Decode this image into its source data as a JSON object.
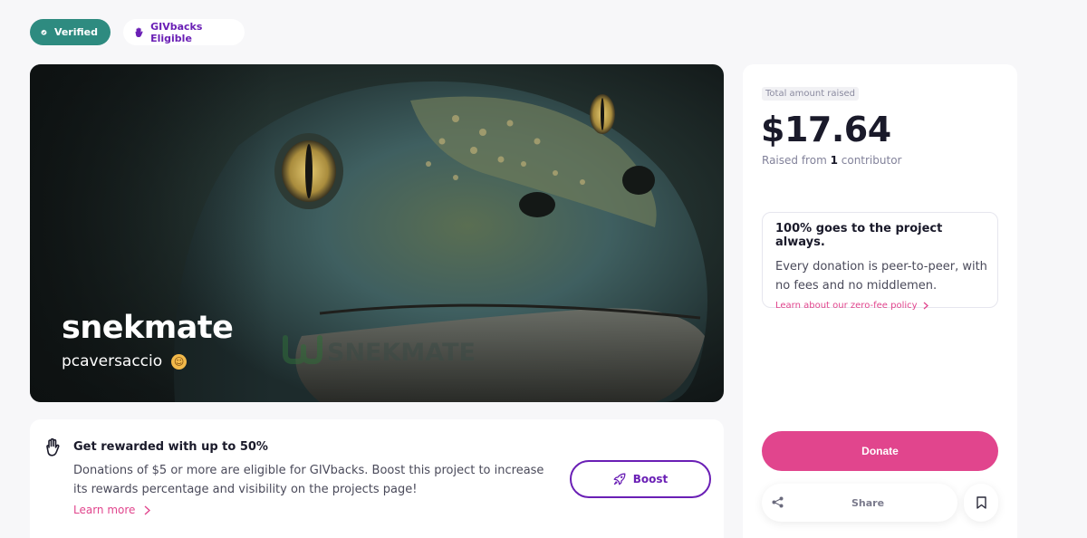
{
  "badges": {
    "verified": "Verified",
    "givbacks": "GIVbacks Eligible"
  },
  "project": {
    "title": "snekmate",
    "author": "pcaversaccio",
    "watermark": "SNEKMATE"
  },
  "donation_panel": {
    "total_label": "Total amount raised",
    "amount": "$17.64",
    "raised_prefix": "Raised from ",
    "contributor_count": "1",
    "raised_suffix": " contributor",
    "fee_card": {
      "title": "100% goes to the project always.",
      "body": "Every donation is peer-to-peer, with no fees and no middlemen.",
      "link": "Learn about our zero-fee policy"
    },
    "donate_label": "Donate",
    "share_label": "Share"
  },
  "reward_card": {
    "title": "Get rewarded with up to 50%",
    "body": "Donations of $5 or more are eligible for GIVbacks. Boost this project to increase its rewards percentage and visibility on the projects page!",
    "link": "Learn more",
    "boost_label": "Boost"
  },
  "colors": {
    "verified_bg": "#2e8b80",
    "givbacks_text": "#6a1fb5",
    "donate_pink": "#e1458d",
    "boost_purple": "#6a1fb5",
    "page_bg": "#f7f7f9"
  },
  "icons": {
    "verified": "check-badge-icon",
    "givbacks": "raised-hand-icon",
    "fee_link": "chevron-right-icon",
    "share": "share-icon",
    "bookmark": "bookmark-icon",
    "reward": "raised-hand-icon",
    "boost": "rocket-icon"
  }
}
